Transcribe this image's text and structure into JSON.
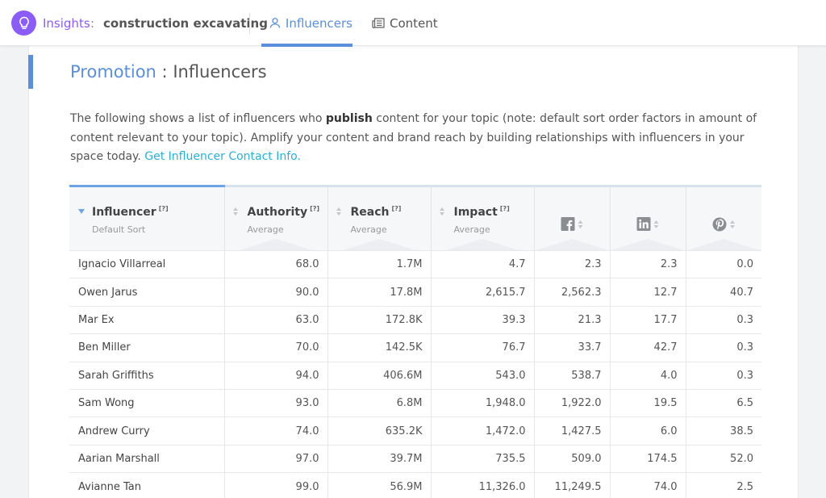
{
  "header": {
    "app_name": "Insights",
    "separator": ":",
    "topic": "construction excavating",
    "tabs": [
      {
        "label": "Influencers",
        "icon": "person-icon",
        "active": true
      },
      {
        "label": "Content",
        "icon": "newspaper-icon",
        "active": false
      }
    ]
  },
  "page": {
    "title_section": "Promotion",
    "title_separator": ":",
    "title_page": "Influencers",
    "desc_1": "The following shows a list of influencers who ",
    "desc_bold": "publish",
    "desc_2": " content for your topic (note: default sort order factors in amount of content relevant to your topic). Amplify your content and brand reach by building relationships with influencers in your space today. ",
    "desc_link": "Get Influencer Contact Info."
  },
  "table": {
    "help_marker": "[?]",
    "columns": [
      {
        "label": "Influencer",
        "sub": "Default Sort"
      },
      {
        "label": "Authority",
        "sub": "Average"
      },
      {
        "label": "Reach",
        "sub": "Average"
      },
      {
        "label": "Impact",
        "sub": "Average"
      }
    ],
    "social_columns": [
      "facebook-icon",
      "linkedin-icon",
      "pinterest-icon"
    ],
    "rows": [
      {
        "name": "Ignacio Villarreal",
        "authority": "68.0",
        "reach": "1.7M",
        "impact": "4.7",
        "facebook": "2.3",
        "linkedin": "2.3",
        "pinterest": "0.0"
      },
      {
        "name": "Owen Jarus",
        "authority": "90.0",
        "reach": "17.8M",
        "impact": "2,615.7",
        "facebook": "2,562.3",
        "linkedin": "12.7",
        "pinterest": "40.7"
      },
      {
        "name": "Mar Ex",
        "authority": "63.0",
        "reach": "172.8K",
        "impact": "39.3",
        "facebook": "21.3",
        "linkedin": "17.7",
        "pinterest": "0.3"
      },
      {
        "name": "Ben Miller",
        "authority": "70.0",
        "reach": "142.5K",
        "impact": "76.7",
        "facebook": "33.7",
        "linkedin": "42.7",
        "pinterest": "0.3"
      },
      {
        "name": "Sarah Griffiths",
        "authority": "94.0",
        "reach": "406.6M",
        "impact": "543.0",
        "facebook": "538.7",
        "linkedin": "4.0",
        "pinterest": "0.3"
      },
      {
        "name": "Sam Wong",
        "authority": "93.0",
        "reach": "6.8M",
        "impact": "1,948.0",
        "facebook": "1,922.0",
        "linkedin": "19.5",
        "pinterest": "6.5"
      },
      {
        "name": "Andrew Curry",
        "authority": "74.0",
        "reach": "635.2K",
        "impact": "1,472.0",
        "facebook": "1,427.5",
        "linkedin": "6.0",
        "pinterest": "38.5"
      },
      {
        "name": "Aarian Marshall",
        "authority": "97.0",
        "reach": "39.7M",
        "impact": "735.5",
        "facebook": "509.0",
        "linkedin": "174.5",
        "pinterest": "52.0"
      },
      {
        "name": "Avianne Tan",
        "authority": "99.0",
        "reach": "56.9M",
        "impact": "11,326.0",
        "facebook": "11,249.5",
        "linkedin": "74.0",
        "pinterest": "2.5"
      }
    ]
  },
  "colors": {
    "accent_purple": "#8b5cf6",
    "accent_blue": "#5b8fd9",
    "link_cyan": "#2ab0d8"
  }
}
